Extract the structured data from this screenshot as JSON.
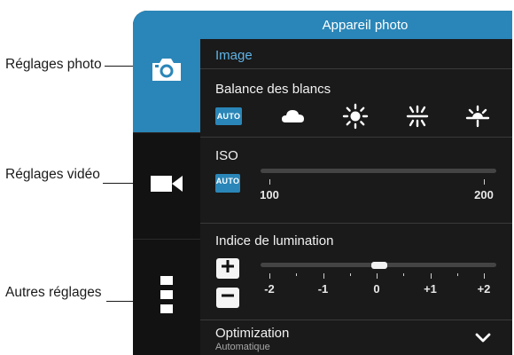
{
  "annotations": {
    "photo_settings": "Réglages photo",
    "video_settings": "Réglages vidéo",
    "other_settings": "Autres réglages"
  },
  "panel": {
    "title": "Appareil photo",
    "section": "Image",
    "white_balance": {
      "label": "Balance des blancs",
      "auto_badge": "AUTO",
      "options": [
        "auto-icon",
        "cloud-icon",
        "sun-icon",
        "fluorescent-icon",
        "incandescent-icon"
      ],
      "selected": "AUTO"
    },
    "iso": {
      "label": "ISO",
      "auto_badge": "AUTO",
      "min_label": "100",
      "max_label": "200"
    },
    "exposure": {
      "label": "Indice de lumination",
      "ticks": [
        "-2",
        "-1",
        "0",
        "+1",
        "+2"
      ],
      "value": 0,
      "plus_icon": "plus-icon",
      "minus_icon": "minus-icon"
    },
    "optimization": {
      "label": "Optimization",
      "value": "Automatique",
      "icon": "chevron-down-icon"
    }
  },
  "tabs": [
    {
      "name": "photo",
      "icon": "camera-icon",
      "active": true
    },
    {
      "name": "video",
      "icon": "video-camera-icon",
      "active": false
    },
    {
      "name": "other",
      "icon": "more-vertical-icon",
      "active": false
    }
  ],
  "colors": {
    "accent": "#2a86b8",
    "section_title": "#5eb3e6",
    "panel_bg": "#1a1a1a"
  }
}
